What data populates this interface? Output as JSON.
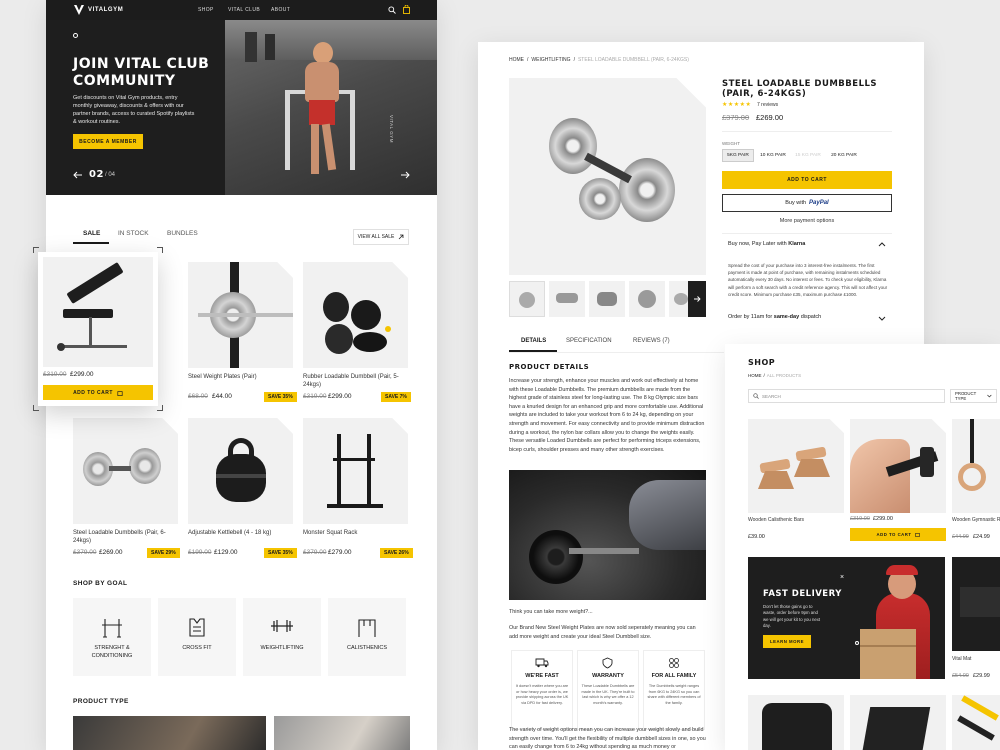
{
  "brand": {
    "name": "VITALGYM",
    "accent": "#f5c400"
  },
  "left": {
    "nav": [
      "SHOP",
      "VITAL CLUB",
      "ABOUT"
    ],
    "hero": {
      "title_line1": "JOIN VITAL CLUB",
      "title_line2": "COMMUNITY",
      "desc": "Get discounts on Vital Gym products, entry monthly giveaway, discounts & offers with our partner brands, access to curated Spotify playlists & workout routines.",
      "cta": "BECOME A MEMBER",
      "slide_current": "02",
      "slide_total": "/ 04",
      "side_label": "VITAL GYM"
    },
    "tabs": [
      "SALE",
      "IN STOCK",
      "BUNDLES"
    ],
    "view_all": "VIEW ALL SALE",
    "products": [
      {
        "name": "",
        "old": "£319.00",
        "price": "£299.00",
        "badge": "",
        "cta": "ADD TO CART"
      },
      {
        "name": "Steel Weight Plates (Pair)",
        "old": "£68.00",
        "price": "£44.00",
        "badge": "SAVE 35%"
      },
      {
        "name": "Rubber Loadable Dumbbell (Pair, 5-24kgs)",
        "old": "£319.00",
        "price": "£299.00",
        "badge": "SAVE 7%"
      },
      {
        "name": "Steel Loadable Dumbbells (Pair, 6-24kgs)",
        "old": "£379.00",
        "price": "£269.00",
        "badge": "SAVE 29%"
      },
      {
        "name": "Adjustable Kettlebell (4 - 18 kg)",
        "old": "£199.00",
        "price": "£129.00",
        "badge": "SAVE 35%"
      },
      {
        "name": "Monster Squat Rack",
        "old": "£379.00",
        "price": "£279.00",
        "badge": "SAVE 26%"
      }
    ],
    "goal_title": "SHOP BY GOAL",
    "goals": [
      "STRENGHT &",
      "CONDITIONING",
      "CROSS FIT",
      "WEIGHTLIFTING",
      "CALISTHENICS"
    ],
    "product_type_title": "PRODUCT TYPE"
  },
  "middle": {
    "breadcrumb": [
      "HOME",
      "/",
      "WEIGHTLIFTING",
      "/",
      "STEEL LOADABLE DUMBBELL (PAIR, 6-24KGS)"
    ],
    "title_line1": "STEEL LOADABLE DUMBBELLS",
    "title_line2": "(PAIR, 6-24KGS)",
    "stars": "★★★★★",
    "reviews": "7 reviews",
    "old_price": "£379.00",
    "price": "£269.00",
    "weight_label": "WEIGHT",
    "weights": [
      "5KG PAIR",
      "10 KG PAIR",
      "15 KG PAIR",
      "20 KG PAIR"
    ],
    "add_to_cart": "ADD TO CART",
    "buy_with": "Buy with",
    "paypal": "PayPal",
    "more_payment": "More payment options",
    "klarna_title": "Buy now, Pay Later with",
    "klarna_brand": "Klarna",
    "klarna_text": "Spread the cost of your purchase into 3 interest-free instalments. The first payment is made at point of purchase, with remaining instalments scheduled automatically every 30 days. No interest or fees. To check your eligibility, Klarna will perform a soft search with a credit reference agency. This will not affect your credit score. Minimum purchase £35, maximum purchase £1000.",
    "order_by": "Order by 11am for",
    "same_day": "same-day",
    "dispatch": "dispatch",
    "tabs": [
      "DETAILS",
      "SPECIFICATION",
      "REVIEWS (7)"
    ],
    "details_title": "PRODUCT DETAILS",
    "details_text": "Increase your strength, enhance your muscles and work out effectively at home with these Loadable Dumbbells. The premium dumbbells are made from the highest grade of stainless steel for long-lasting use. The 8 kg Olympic size bars have a knurled design for an enhanced grip and more comfortable use. Additional weights are included to take your workout from 6 to 24 kg, depending on your strength and movement. For easy connectivity and to provide minimum distraction during a workout, the nylon bar collars allow you to change the weights easily. These versatile Loaded Dumbbells are perfect for performing triceps extensions, bicep curls, shoulder presses and many other strength exercises.",
    "think": "Think you can take more weight?...",
    "brand_new": "Our Brand New Steel Weight Plates are now sold seperately meaning you can add more weight and create your ideal Steel Dumbbell size.",
    "features": [
      {
        "title": "WE'RE FAST",
        "text": "It doesn't matter where you are or how heavy your order is, we provide shipping across the UK via DPD for fast delivery."
      },
      {
        "title": "WARRANTY",
        "text": "These Loadable Dumbbells are made in the UK. They're built to last which is why we offer a 12 month's warranty."
      },
      {
        "title": "FOR ALL FAMILY",
        "text": "The Dumbbells weight ranges from 6KG to 24KG so you can share with different members of the family."
      }
    ],
    "bottom_text": "The variety of weight options mean you can increase your weight slowly and build strength over time. You'll get the flexibility of multiple dumbbell sizes in one, so you can easily change from 6 to 24kg without spending as much money or"
  },
  "right": {
    "title": "SHOP",
    "breadcrumb": [
      "HOME",
      "/",
      "ALL PRODUCTS"
    ],
    "search_placeholder": "SEARCH",
    "filter": "PRODUCT TYPE",
    "products": [
      {
        "name": "Wooden Calisthenic Bars",
        "old": "",
        "price": "£39.00"
      },
      {
        "name": "",
        "old": "£319.00",
        "price": "£299.00",
        "cta": "ADD TO CART"
      },
      {
        "name": "Wooden Gymnastic R",
        "old": "£44.99",
        "price": "£24.99"
      }
    ],
    "promo": {
      "title": "FAST DELIVERY",
      "text": "Don't let those gains go to waste, order before 9pm and we will get your kit to you next day.",
      "cta": "LEARN MORE"
    },
    "mat": {
      "name": "Vital Mat",
      "old": "£54.00",
      "price": "£29.99"
    }
  }
}
